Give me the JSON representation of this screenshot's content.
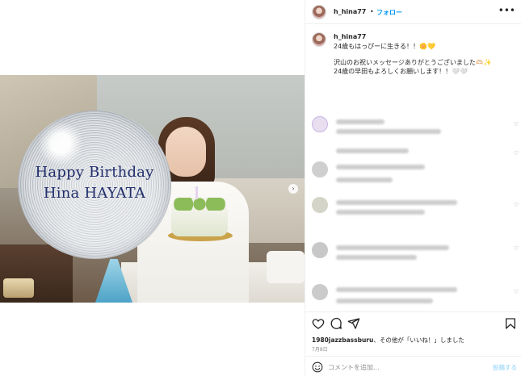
{
  "post": {
    "username": "h_hina77",
    "follow_label": "フォロー",
    "separator": "•",
    "more_label": "•••"
  },
  "photo": {
    "balloon_line1": "Happy Birthday",
    "balloon_line2": "Hina HAYATA",
    "carousel_next": "›"
  },
  "caption": {
    "username": "h_hina77",
    "line1": "24歳もはっぴーに生きる！！🌼💛",
    "line2": "沢山のお祝いメッセージありがとうございました🫶🏻✨",
    "line3": "24歳の早田もよろしくお願いします！！🤍🤍"
  },
  "comments": {
    "heart_icon": "heart-outline",
    "heart_glyph": "♡"
  },
  "actions": {
    "likes_user": "1980jazzbassburu",
    "likes_suffix": "、その他が「いいね！」しました",
    "date": "7月8日",
    "icons": [
      "heart-icon",
      "comment-icon",
      "share-icon",
      "bookmark-icon"
    ]
  },
  "comment_box": {
    "placeholder": "コメントを追加...",
    "post_label": "投稿する"
  },
  "colors": {
    "accent": "#0095f6",
    "text": "#262626",
    "muted": "#8e8e8e",
    "post_disabled": "#b2dffc",
    "balloon_text": "#1f2d6b"
  }
}
